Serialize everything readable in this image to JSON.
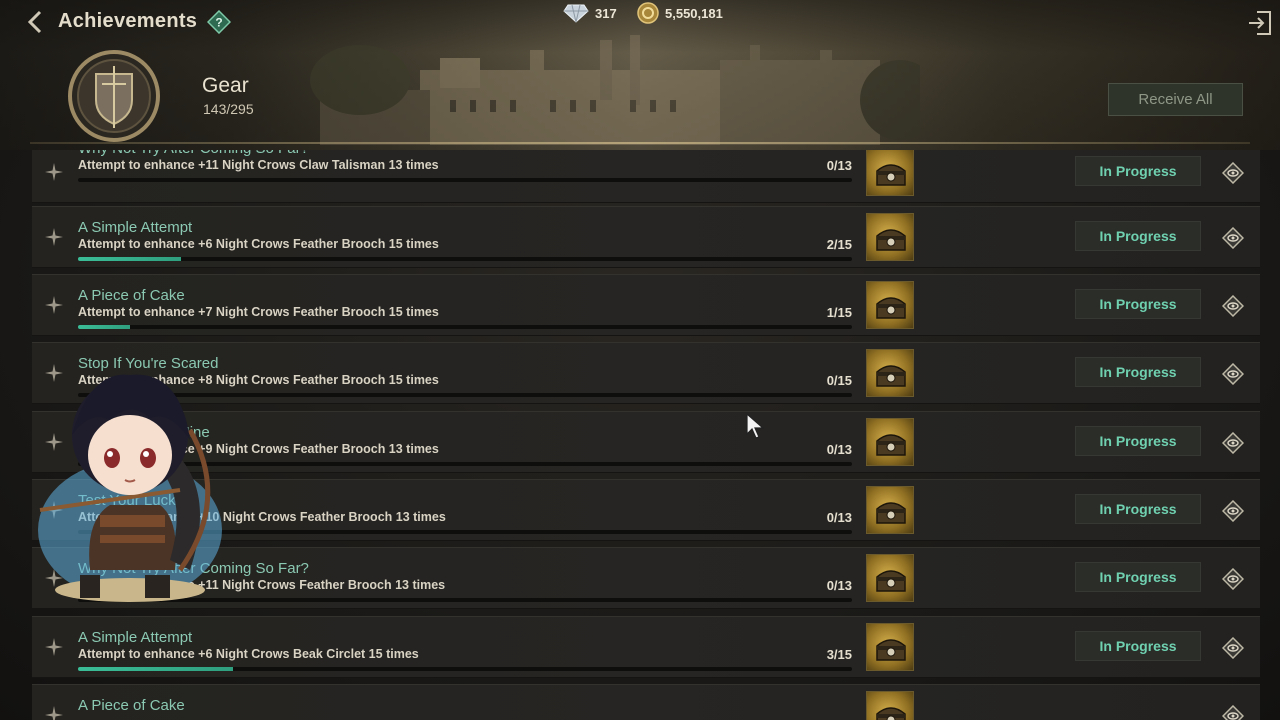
{
  "header": {
    "title": "Achievements",
    "currencies": [
      {
        "icon": "diamond-icon",
        "value": "317"
      },
      {
        "icon": "gold-coin-icon",
        "value": "5,550,181"
      }
    ]
  },
  "category": {
    "name": "Gear",
    "progress": "143/295",
    "receive_all_label": "Receive All"
  },
  "rows": [
    {
      "title": "Why Not Try After Coming So Far?",
      "desc": "Attempt to enhance +11 Night Crows Claw Talisman 13 times",
      "count": "0/13",
      "progress": 0,
      "status": "In Progress"
    },
    {
      "title": "A Simple Attempt",
      "desc": "Attempt to enhance +6 Night Crows Feather Brooch 15 times",
      "count": "2/15",
      "progress": 0.1333,
      "status": "In Progress"
    },
    {
      "title": "A Piece of Cake",
      "desc": "Attempt to enhance +7 Night Crows Feather Brooch 15 times",
      "count": "1/15",
      "progress": 0.0667,
      "status": "In Progress"
    },
    {
      "title": "Stop If You're Scared",
      "desc": "Attempt to enhance +8 Night Crows Feather Brooch 15 times",
      "count": "0/15",
      "progress": 0,
      "status": "In Progress"
    },
    {
      "title": "Cloud Number Nine",
      "desc": "Attempt to enhance +9 Night Crows Feather Brooch 13 times",
      "count": "0/13",
      "progress": 0,
      "status": "In Progress"
    },
    {
      "title": "Test Your Luck",
      "desc": "Attempt to enhance +10 Night Crows Feather Brooch 13 times",
      "count": "0/13",
      "progress": 0,
      "status": "In Progress"
    },
    {
      "title": "Why Not Try After Coming So Far?",
      "desc": "Attempt to enhance +11 Night Crows Feather Brooch 13 times",
      "count": "0/13",
      "progress": 0,
      "status": "In Progress"
    },
    {
      "title": "A Simple Attempt",
      "desc": "Attempt to enhance +6 Night Crows Beak Circlet 15 times",
      "count": "3/15",
      "progress": 0.2,
      "status": "In Progress"
    },
    {
      "title": "A Piece of Cake",
      "desc": "",
      "count": "",
      "progress": 0,
      "status": ""
    }
  ],
  "colors": {
    "accent_teal": "#6fd1b0",
    "progress_fill": "#3bbd97",
    "title_teal": "#8bc9b2"
  }
}
